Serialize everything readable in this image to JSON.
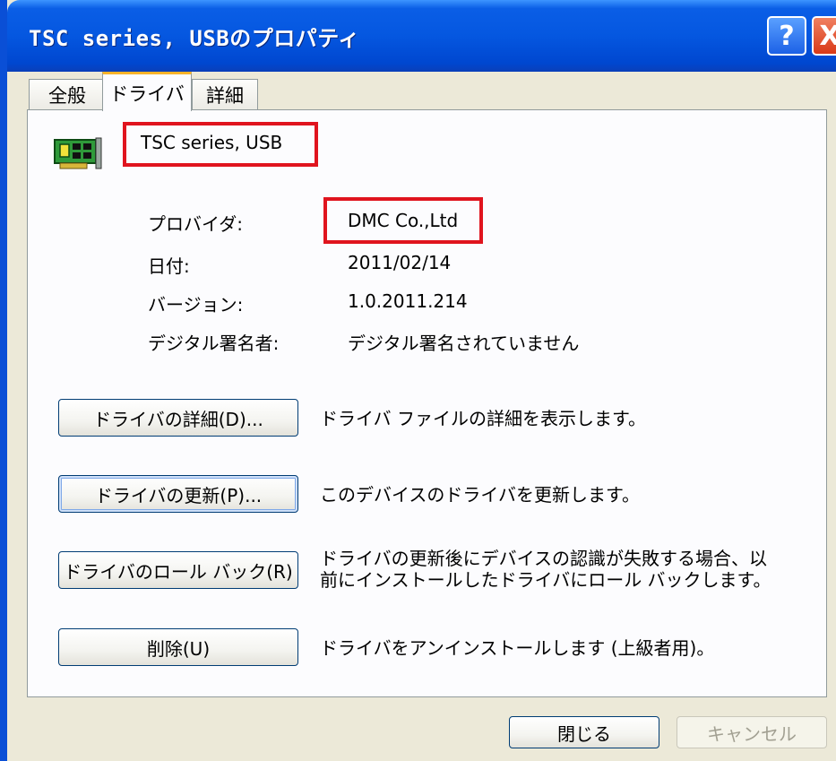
{
  "window": {
    "title": "TSC series, USBのプロパティ",
    "help_glyph": "?",
    "close_glyph": "X",
    "accent_color": "#0a5ee6",
    "highlight_color": "#e0141e"
  },
  "tabs": [
    {
      "label": "全般",
      "selected": false
    },
    {
      "label": "ドライバ",
      "selected": true
    },
    {
      "label": "詳細",
      "selected": false
    }
  ],
  "device": {
    "icon": "network-card-icon",
    "name": "TSC series, USB"
  },
  "info": {
    "provider_label": "プロバイダ:",
    "provider_value": "DMC Co.,Ltd",
    "date_label": "日付:",
    "date_value": "2011/02/14",
    "version_label": "バージョン:",
    "version_value": "1.0.2011.214",
    "signer_label": "デジタル署名者:",
    "signer_value": "デジタル署名されていません"
  },
  "actions": {
    "details_label": "ドライバの詳細(D)...",
    "details_desc": "ドライバ ファイルの詳細を表示します。",
    "update_label": "ドライバの更新(P)...",
    "update_desc": "このデバイスのドライバを更新します。",
    "rollback_label": "ドライバのロール バック(R)",
    "rollback_desc_line1": "ドライバの更新後にデバイスの認識が失敗する場合、以",
    "rollback_desc_line2": "前にインストールしたドライバにロール バックします。",
    "uninstall_label": "削除(U)",
    "uninstall_desc": "ドライバをアンインストールします (上級者用)。"
  },
  "footer": {
    "close_label": "閉じる",
    "cancel_label": "キャンセル"
  }
}
